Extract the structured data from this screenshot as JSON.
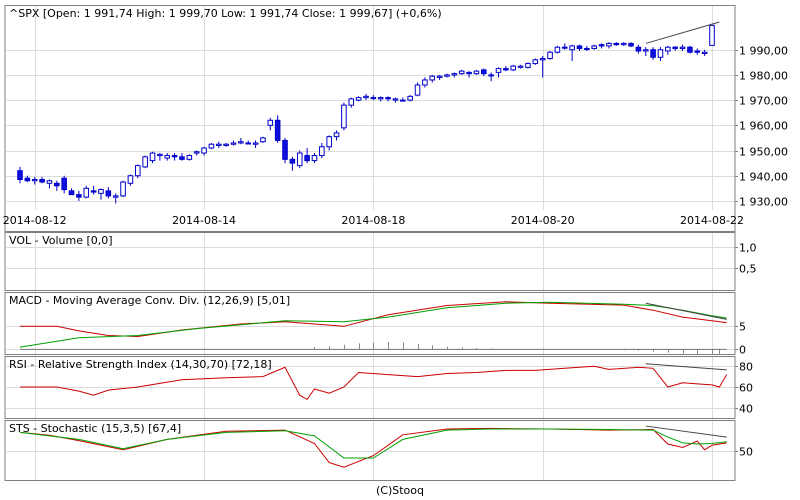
{
  "footer": "(C)Stooq",
  "colors": {
    "up_fill": "#ffffff",
    "down_fill": "#1010dd",
    "candle_stroke": "#0000cc",
    "grid": "#dcdcdc",
    "macd_line": "#cc0000",
    "signal_line": "#00a000",
    "trend_line": "#444444"
  },
  "chart_data": [
    {
      "type": "candlestick",
      "title": "^SPX [Open: 1 991,74  High: 1 999,70  Low: 1 991,74  Close: 1 999,67] (+0,6%)",
      "x_ticks": [
        "2014-08-12",
        "2014-08-14",
        "2014-08-18",
        "2014-08-20",
        "2014-08-22"
      ],
      "x_tick_index": [
        2,
        25,
        48,
        71,
        94
      ],
      "ylim": [
        1926,
        2001
      ],
      "y_ticks": [
        1930,
        1940,
        1950,
        1960,
        1970,
        1980,
        1990
      ],
      "y_tick_labels": [
        "1 930,00",
        "1 940,00",
        "1 950,00",
        "1 960,00",
        "1 970,00",
        "1 980,00",
        "1 990,00"
      ],
      "ohlc": [
        [
          1942.0,
          1943.5,
          1937.0,
          1938.5
        ],
        [
          1939.0,
          1940.0,
          1937.5,
          1938.0
        ],
        [
          1938.0,
          1939.5,
          1936.5,
          1938.5
        ],
        [
          1938.5,
          1939.5,
          1937.0,
          1937.5
        ],
        [
          1937.0,
          1938.5,
          1935.0,
          1938.0
        ],
        [
          1937.0,
          1938.0,
          1934.0,
          1936.0
        ],
        [
          1939.0,
          1940.0,
          1933.0,
          1934.5
        ],
        [
          1934.0,
          1935.0,
          1932.5,
          1932.5
        ],
        [
          1932.5,
          1934.0,
          1930.0,
          1931.5
        ],
        [
          1931.5,
          1936.0,
          1931.0,
          1935.0
        ],
        [
          1934.0,
          1936.0,
          1932.5,
          1933.5
        ],
        [
          1933.0,
          1935.0,
          1930.5,
          1934.5
        ],
        [
          1934.0,
          1935.5,
          1931.0,
          1932.0
        ],
        [
          1931.5,
          1933.0,
          1929.0,
          1932.0
        ],
        [
          1932.0,
          1938.0,
          1931.5,
          1937.5
        ],
        [
          1937.0,
          1940.5,
          1936.0,
          1940.0
        ],
        [
          1940.0,
          1944.5,
          1939.0,
          1944.0
        ],
        [
          1943.5,
          1948.0,
          1943.0,
          1947.5
        ],
        [
          1946.0,
          1949.5,
          1945.0,
          1949.0
        ],
        [
          1948.0,
          1949.0,
          1946.0,
          1948.5
        ],
        [
          1947.0,
          1949.0,
          1946.0,
          1948.0
        ],
        [
          1948.0,
          1949.0,
          1946.0,
          1947.5
        ],
        [
          1947.5,
          1949.0,
          1946.0,
          1946.5
        ],
        [
          1946.5,
          1948.5,
          1946.0,
          1948.0
        ],
        [
          1949.0,
          1950.0,
          1948.0,
          1949.5
        ],
        [
          1949.0,
          1951.5,
          1948.0,
          1951.0
        ],
        [
          1951.0,
          1953.0,
          1950.5,
          1952.5
        ],
        [
          1952.0,
          1953.5,
          1951.0,
          1952.5
        ],
        [
          1952.0,
          1953.0,
          1951.5,
          1952.5
        ],
        [
          1952.5,
          1954.0,
          1952.0,
          1953.0
        ],
        [
          1953.0,
          1955.0,
          1952.5,
          1953.5
        ],
        [
          1953.0,
          1954.0,
          1952.5,
          1953.0
        ],
        [
          1952.5,
          1954.0,
          1951.0,
          1953.0
        ],
        [
          1953.5,
          1955.5,
          1953.0,
          1955.0
        ],
        [
          1960.0,
          1963.0,
          1958.0,
          1962.0
        ],
        [
          1962.0,
          1964.0,
          1953.0,
          1954.0
        ],
        [
          1954.0,
          1955.0,
          1945.0,
          1946.5
        ],
        [
          1946.5,
          1947.5,
          1942.0,
          1945.0
        ],
        [
          1944.0,
          1950.0,
          1943.0,
          1949.0
        ],
        [
          1948.0,
          1951.0,
          1945.0,
          1946.0
        ],
        [
          1946.0,
          1949.0,
          1945.0,
          1948.0
        ],
        [
          1948.0,
          1953.0,
          1947.0,
          1951.5
        ],
        [
          1951.5,
          1956.0,
          1950.0,
          1955.5
        ],
        [
          1955.5,
          1958.0,
          1954.0,
          1957.0
        ],
        [
          1959.0,
          1969.0,
          1958.0,
          1968.0
        ],
        [
          1968.0,
          1971.0,
          1967.0,
          1970.5
        ],
        [
          1970.0,
          1971.5,
          1969.5,
          1971.0
        ],
        [
          1971.0,
          1972.5,
          1970.0,
          1971.5
        ],
        [
          1971.0,
          1972.0,
          1970.0,
          1971.0
        ],
        [
          1970.5,
          1971.5,
          1969.5,
          1971.0
        ],
        [
          1971.0,
          1971.5,
          1969.5,
          1970.5
        ],
        [
          1970.0,
          1971.0,
          1969.0,
          1970.5
        ],
        [
          1970.0,
          1971.0,
          1970.0,
          1970.0
        ],
        [
          1970.0,
          1972.0,
          1969.5,
          1971.5
        ],
        [
          1972.0,
          1977.0,
          1971.5,
          1976.0
        ],
        [
          1976.0,
          1979.0,
          1975.0,
          1978.0
        ],
        [
          1978.0,
          1980.0,
          1977.0,
          1979.5
        ],
        [
          1979.0,
          1980.0,
          1978.0,
          1979.5
        ],
        [
          1979.5,
          1980.5,
          1979.0,
          1980.0
        ],
        [
          1980.0,
          1981.0,
          1979.0,
          1980.5
        ],
        [
          1980.5,
          1982.0,
          1980.0,
          1981.5
        ],
        [
          1981.0,
          1981.5,
          1979.0,
          1980.5
        ],
        [
          1980.5,
          1982.0,
          1980.0,
          1981.5
        ],
        [
          1982.0,
          1982.5,
          1979.5,
          1980.5
        ],
        [
          1980.0,
          1981.0,
          1977.5,
          1980.0
        ],
        [
          1981.0,
          1983.0,
          1979.0,
          1982.5
        ],
        [
          1982.5,
          1983.5,
          1981.5,
          1982.0
        ],
        [
          1982.0,
          1984.0,
          1981.5,
          1983.5
        ],
        [
          1983.0,
          1984.0,
          1982.5,
          1983.5
        ],
        [
          1983.0,
          1985.0,
          1982.5,
          1984.5
        ],
        [
          1984.5,
          1986.5,
          1984.0,
          1986.0
        ],
        [
          1986.0,
          1987.5,
          1979.0,
          1986.5
        ],
        [
          1986.5,
          1989.5,
          1986.0,
          1989.0
        ],
        [
          1989.0,
          1991.5,
          1988.5,
          1991.0
        ],
        [
          1991.0,
          1992.5,
          1990.0,
          1991.0
        ],
        [
          1990.0,
          1992.0,
          1985.5,
          1991.5
        ],
        [
          1991.5,
          1992.0,
          1989.5,
          1990.5
        ],
        [
          1990.5,
          1991.5,
          1989.5,
          1990.5
        ],
        [
          1990.5,
          1992.0,
          1990.0,
          1991.5
        ],
        [
          1992.0,
          1992.5,
          1990.5,
          1991.5
        ],
        [
          1991.5,
          1993.0,
          1990.5,
          1992.5
        ],
        [
          1992.5,
          1993.0,
          1991.5,
          1992.0
        ],
        [
          1992.0,
          1993.0,
          1991.5,
          1992.5
        ],
        [
          1992.5,
          1993.0,
          1991.0,
          1991.5
        ],
        [
          1991.0,
          1992.0,
          1988.5,
          1989.5
        ],
        [
          1989.5,
          1991.0,
          1987.5,
          1990.0
        ],
        [
          1990.0,
          1991.0,
          1986.0,
          1987.0
        ],
        [
          1987.0,
          1991.0,
          1985.5,
          1990.0
        ],
        [
          1989.5,
          1991.5,
          1988.0,
          1991.0
        ],
        [
          1991.0,
          1991.5,
          1989.5,
          1990.5
        ],
        [
          1990.5,
          1992.0,
          1989.5,
          1991.0
        ],
        [
          1991.0,
          1991.5,
          1988.5,
          1989.0
        ],
        [
          1989.5,
          1990.5,
          1988.0,
          1989.0
        ],
        [
          1988.5,
          1990.0,
          1987.5,
          1989.0
        ],
        [
          1991.74,
          1999.7,
          1991.74,
          1999.67
        ]
      ],
      "trend_line": {
        "from": [
          85,
          1992.5
        ],
        "to": [
          95,
          2001.0
        ]
      }
    },
    {
      "type": "line",
      "title": "VOL - Volume [0,0]",
      "ylim": [
        0,
        1.2
      ],
      "y_ticks": [
        0.5,
        1.0
      ],
      "y_tick_labels": [
        "0,5",
        "1,0"
      ],
      "series": []
    },
    {
      "type": "line",
      "title": "MACD - Moving Average Conv. Div. (12,26,9) [5,01]",
      "ylim": [
        -1,
        12
      ],
      "y_ticks": [
        0,
        5
      ],
      "y_tick_labels": [
        "0",
        "5"
      ],
      "series": [
        {
          "values": [
            [
              0,
              5.0
            ],
            [
              5,
              5.0
            ],
            [
              8,
              4.0
            ],
            [
              12,
              3.0
            ],
            [
              16,
              2.8
            ],
            [
              22,
              4.2
            ],
            [
              30,
              5.5
            ],
            [
              36,
              6.0
            ],
            [
              44,
              5.0
            ],
            [
              50,
              7.5
            ],
            [
              58,
              9.5
            ],
            [
              66,
              10.3
            ],
            [
              72,
              10.0
            ],
            [
              82,
              9.6
            ],
            [
              86,
              8.5
            ],
            [
              90,
              7.0
            ],
            [
              94,
              6.2
            ],
            [
              96,
              5.8
            ]
          ]
        },
        {
          "values": [
            [
              0,
              0.5
            ],
            [
              8,
              2.5
            ],
            [
              16,
              3.0
            ],
            [
              24,
              4.5
            ],
            [
              36,
              6.2
            ],
            [
              44,
              6.0
            ],
            [
              50,
              7.0
            ],
            [
              58,
              9.0
            ],
            [
              66,
              10.0
            ],
            [
              72,
              10.2
            ],
            [
              82,
              9.8
            ],
            [
              86,
              9.5
            ],
            [
              90,
              8.5
            ],
            [
              94,
              7.3
            ],
            [
              96,
              6.8
            ]
          ]
        },
        {
          "values": [
            [
              0,
              0
            ],
            [
              96,
              0
            ]
          ]
        }
      ],
      "histogram": [
        [
          40,
          0.5
        ],
        [
          42,
          0.7
        ],
        [
          44,
          1.0
        ],
        [
          46,
          1.3
        ],
        [
          48,
          1.5
        ],
        [
          50,
          1.6
        ],
        [
          52,
          1.5
        ],
        [
          54,
          1.2
        ],
        [
          56,
          0.9
        ],
        [
          58,
          0.6
        ],
        [
          60,
          0.4
        ],
        [
          62,
          0.3
        ],
        [
          64,
          0.2
        ],
        [
          82,
          -0.2
        ],
        [
          84,
          -0.3
        ],
        [
          86,
          -0.5
        ],
        [
          88,
          -0.7
        ],
        [
          90,
          -0.9
        ],
        [
          92,
          -1.0
        ],
        [
          94,
          -1.0
        ],
        [
          95,
          -1.0
        ]
      ],
      "trend_line": {
        "from": [
          85,
          10.0
        ],
        "to": [
          96,
          6.5
        ]
      }
    },
    {
      "type": "line",
      "title": "RSI - Relative Strength Index (14,30,70) [72,18]",
      "ylim": [
        30,
        88
      ],
      "y_ticks": [
        40,
        60,
        80
      ],
      "y_tick_labels": [
        "40",
        "60",
        "80"
      ],
      "series": [
        {
          "values": [
            [
              0,
              60
            ],
            [
              5,
              60
            ],
            [
              8,
              56
            ],
            [
              10,
              52
            ],
            [
              12,
              57
            ],
            [
              16,
              60
            ],
            [
              22,
              67
            ],
            [
              28,
              69
            ],
            [
              33,
              70
            ],
            [
              36,
              79
            ],
            [
              38,
              52
            ],
            [
              39,
              48
            ],
            [
              40,
              58
            ],
            [
              42,
              54
            ],
            [
              44,
              60
            ],
            [
              46,
              74
            ],
            [
              50,
              72
            ],
            [
              54,
              70
            ],
            [
              58,
              73
            ],
            [
              62,
              74
            ],
            [
              66,
              76
            ],
            [
              70,
              76
            ],
            [
              74,
              78
            ],
            [
              78,
              80
            ],
            [
              80,
              77
            ],
            [
              84,
              79
            ],
            [
              86,
              78
            ],
            [
              88,
              60
            ],
            [
              90,
              64
            ],
            [
              92,
              63
            ],
            [
              94,
              62
            ],
            [
              95,
              60
            ],
            [
              96,
              72
            ]
          ]
        }
      ],
      "trend_line": {
        "from": [
          85,
          82.5
        ],
        "to": [
          96,
          76.5
        ]
      }
    },
    {
      "type": "line",
      "title": "STS - Stochastic (15,3,5) [67,4]",
      "ylim": [
        0,
        100
      ],
      "y_ticks": [
        50
      ],
      "y_tick_labels": [
        "50"
      ],
      "series": [
        {
          "values": [
            [
              0,
              82
            ],
            [
              4,
              77
            ],
            [
              8,
              68
            ],
            [
              14,
              52
            ],
            [
              20,
              70
            ],
            [
              28,
              84
            ],
            [
              36,
              86
            ],
            [
              40,
              63
            ],
            [
              42,
              30
            ],
            [
              44,
              22
            ],
            [
              48,
              42
            ],
            [
              52,
              78
            ],
            [
              58,
              88
            ],
            [
              64,
              89
            ],
            [
              72,
              88
            ],
            [
              80,
              86
            ],
            [
              86,
              87
            ],
            [
              88,
              62
            ],
            [
              90,
              56
            ],
            [
              92,
              67
            ],
            [
              93,
              52
            ],
            [
              94,
              60
            ],
            [
              96,
              64
            ]
          ]
        },
        {
          "values": [
            [
              0,
              82
            ],
            [
              8,
              70
            ],
            [
              14,
              54
            ],
            [
              20,
              70
            ],
            [
              28,
              82
            ],
            [
              36,
              85
            ],
            [
              40,
              76
            ],
            [
              44,
              38
            ],
            [
              48,
              38
            ],
            [
              52,
              70
            ],
            [
              58,
              86
            ],
            [
              64,
              88
            ],
            [
              72,
              88
            ],
            [
              80,
              87
            ],
            [
              86,
              86
            ],
            [
              88,
              74
            ],
            [
              90,
              64
            ],
            [
              92,
              62
            ],
            [
              94,
              63
            ],
            [
              96,
              66
            ]
          ]
        }
      ],
      "trend_line": {
        "from": [
          85,
          93.0
        ],
        "to": [
          96,
          74.0
        ]
      }
    }
  ]
}
